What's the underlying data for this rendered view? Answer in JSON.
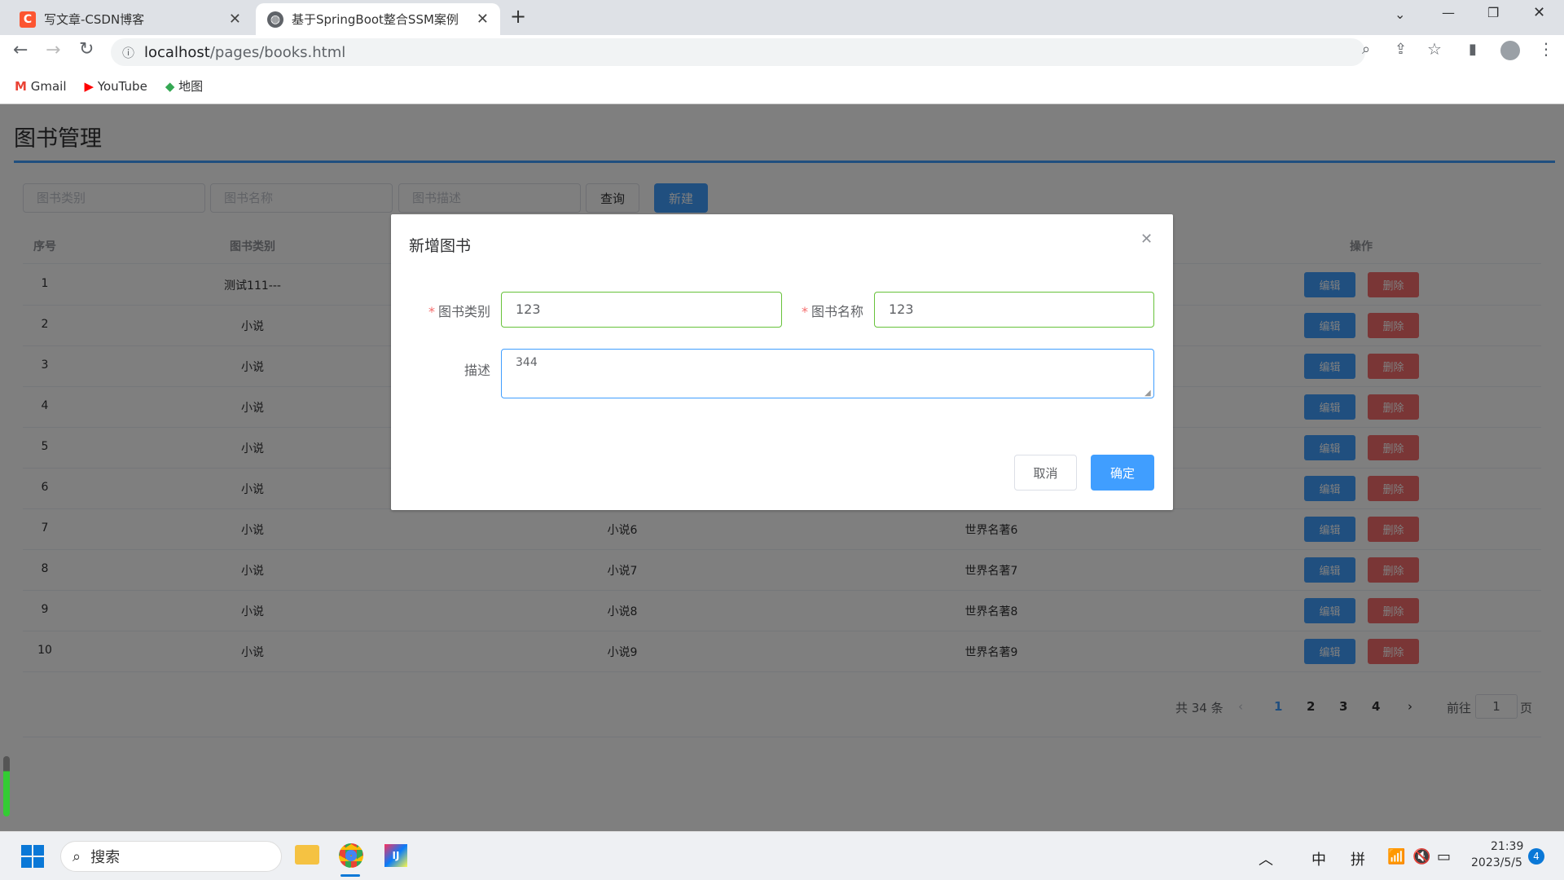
{
  "browser": {
    "tabs": [
      {
        "title": "写文章-CSDN博客",
        "icon": "csdn-icon"
      },
      {
        "title": "基于SpringBoot整合SSM案例",
        "icon": "globe-icon"
      }
    ],
    "url_host": "localhost",
    "url_path": "/pages/books.html",
    "bookmarks": [
      {
        "label": "Gmail"
      },
      {
        "label": "YouTube"
      },
      {
        "label": "地图"
      }
    ]
  },
  "page": {
    "title": "图书管理",
    "search": {
      "type_placeholder": "图书类别",
      "name_placeholder": "图书名称",
      "desc_placeholder": "图书描述",
      "query": "查询",
      "create": "新建"
    },
    "table": {
      "headers": [
        "序号",
        "图书类别",
        "",
        "",
        "操作"
      ],
      "rows": [
        {
          "id": "1",
          "type": "测试111---",
          "name": "",
          "desc": ""
        },
        {
          "id": "2",
          "type": "小说",
          "name": "",
          "desc": ""
        },
        {
          "id": "3",
          "type": "小说",
          "name": "",
          "desc": ""
        },
        {
          "id": "4",
          "type": "小说",
          "name": "",
          "desc": ""
        },
        {
          "id": "5",
          "type": "小说",
          "name": "",
          "desc": ""
        },
        {
          "id": "6",
          "type": "小说",
          "name": "",
          "desc": ""
        },
        {
          "id": "7",
          "type": "小说",
          "name": "小说6",
          "desc": "世界名著6"
        },
        {
          "id": "8",
          "type": "小说",
          "name": "小说7",
          "desc": "世界名著7"
        },
        {
          "id": "9",
          "type": "小说",
          "name": "小说8",
          "desc": "世界名著8"
        },
        {
          "id": "10",
          "type": "小说",
          "name": "小说9",
          "desc": "世界名著9"
        }
      ],
      "edit": "编辑",
      "delete": "删除"
    },
    "pagination": {
      "total": "共 34 条",
      "pages": [
        "1",
        "2",
        "3",
        "4"
      ],
      "current": "1",
      "goto": "前往",
      "goto_value": "1",
      "page_suffix": "页"
    }
  },
  "modal": {
    "title": "新增图书",
    "type_label": "图书类别",
    "type_value": "123",
    "name_label": "图书名称",
    "name_value": "123",
    "desc_label": "描述",
    "desc_value": "344",
    "cancel": "取消",
    "confirm": "确定"
  },
  "taskbar": {
    "search": "搜索",
    "ime1": "中",
    "ime2": "拼",
    "time": "21:39",
    "date": "2023/5/5",
    "notif": "4"
  },
  "colors": {
    "primary": "#409eff",
    "danger": "#f56c6c",
    "valid": "#67c23a"
  }
}
